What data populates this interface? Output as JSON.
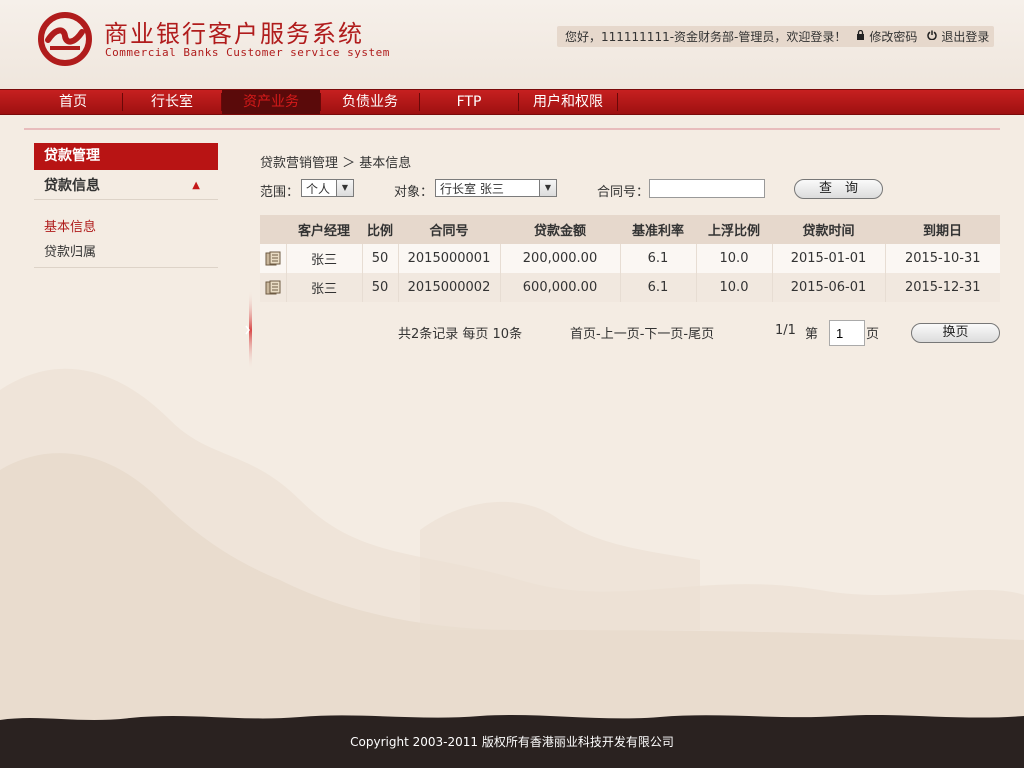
{
  "app": {
    "title_cn": "商业银行客户服务系统",
    "title_en": "Commercial Banks Customer service system"
  },
  "userbar": {
    "greeting": "您好，111111111-资金财务部-管理员，欢迎登录！",
    "change_password": "修改密码",
    "logout": "退出登录"
  },
  "nav": {
    "items": [
      {
        "label": "首页"
      },
      {
        "label": "行长室"
      },
      {
        "label": "资产业务"
      },
      {
        "label": "负债业务"
      },
      {
        "label": "FTP"
      },
      {
        "label": "用户和权限"
      }
    ],
    "active_index": 2
  },
  "sidebar": {
    "header": "贷款管理",
    "section": "贷款信息",
    "items": [
      {
        "label": "基本信息",
        "active": true
      },
      {
        "label": "贷款归属",
        "active": false
      }
    ]
  },
  "breadcrumb": "贷款营销管理 ＞ 基本信息",
  "filters": {
    "scope_label": "范围：",
    "scope_value": "个人",
    "target_label": "对象：",
    "target_value": "行长室 张三",
    "contract_label": "合同号：",
    "contract_value": "",
    "query_button": "查　询"
  },
  "table": {
    "columns": [
      "",
      "客户经理",
      "比例",
      "合同号",
      "贷款金额",
      "基准利率",
      "上浮比例",
      "贷款时间",
      "到期日"
    ],
    "rows": [
      [
        "",
        "张三",
        "50",
        "2015000001",
        "200,000.00",
        "6.1",
        "10.0",
        "2015-01-01",
        "2015-10-31"
      ],
      [
        "",
        "张三",
        "50",
        "2015000002",
        "600,000.00",
        "6.1",
        "10.0",
        "2015-06-01",
        "2015-12-31"
      ]
    ]
  },
  "pager": {
    "summary": "共2条记录 每页 10条",
    "first": "首页",
    "prev": "-上一页-",
    "next": "下一页",
    "last": "-尾页",
    "page_info": "1/1",
    "goto_prefix": "第",
    "goto_value": "1",
    "goto_suffix": "页",
    "goto_button": "换页"
  },
  "footer": {
    "copyright": "Copyright 2003-2011 版权所有香港丽业科技开发有限公司"
  },
  "icons": {
    "logo": "bank-logo-icon",
    "lock": "lock-icon",
    "power": "power-icon",
    "row_action": "document-icon",
    "collapse": "collapse-handle-icon"
  },
  "colors": {
    "brand_red": "#b81414",
    "nav_active_bg": "#5a0a0a",
    "table_header_bg": "#e6d8cc"
  }
}
